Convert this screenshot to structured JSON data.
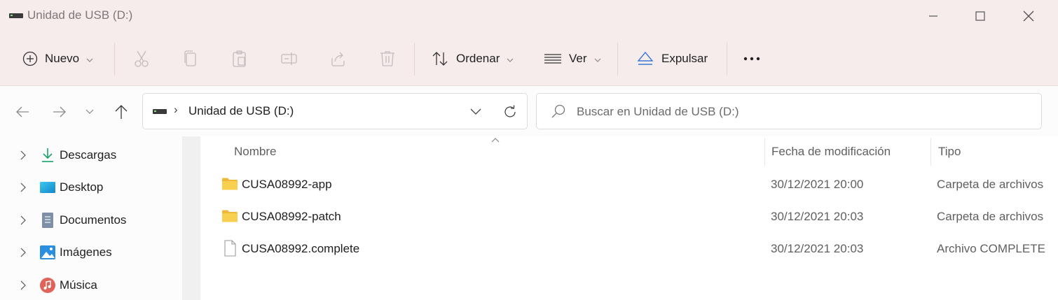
{
  "window": {
    "title": "Unidad de USB (D:)"
  },
  "toolbar": {
    "new_label": "Nuevo",
    "sort_label": "Ordenar",
    "view_label": "Ver",
    "eject_label": "Expulsar"
  },
  "address": {
    "path": "Unidad de USB (D:)",
    "search_placeholder": "Buscar en Unidad de USB (D:)"
  },
  "sidebar": {
    "items": [
      {
        "label": "Descargas",
        "icon": "download-icon"
      },
      {
        "label": "Desktop",
        "icon": "desktop-icon"
      },
      {
        "label": "Documentos",
        "icon": "documents-icon"
      },
      {
        "label": "Imágenes",
        "icon": "pictures-icon"
      },
      {
        "label": "Música",
        "icon": "music-icon"
      }
    ]
  },
  "files": {
    "columns": [
      "Nombre",
      "Fecha de modificación",
      "Tipo"
    ],
    "rows": [
      {
        "name": "CUSA08992-app",
        "date": "30/12/2021 20:00",
        "type": "Carpeta de archivos",
        "icon": "folder-icon"
      },
      {
        "name": "CUSA08992-patch",
        "date": "30/12/2021 20:03",
        "type": "Carpeta de archivos",
        "icon": "folder-icon"
      },
      {
        "name": "CUSA08992.complete",
        "date": "30/12/2021 20:03",
        "type": "Archivo COMPLETE",
        "icon": "file-icon"
      }
    ]
  },
  "colors": {
    "chrome_background": "#f7ecec",
    "content_background": "#ffffff",
    "folder_yellow": "#f8cf4f",
    "drive_led": "#7ee27e"
  }
}
